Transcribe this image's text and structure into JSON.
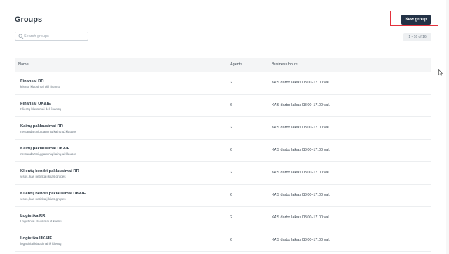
{
  "page": {
    "title": "Groups"
  },
  "toolbar": {
    "new_group_label": "New group"
  },
  "search": {
    "placeholder": "Search groups",
    "value": ""
  },
  "pagination": {
    "label": "1 - 16 of 16"
  },
  "table": {
    "columns": [
      "Name",
      "Agents",
      "Business hours"
    ],
    "rows": [
      {
        "name": "Finansai RR",
        "description": "klientų klausimai dėl finansų",
        "agents": "2",
        "hours": "KAS darbo laikas 08.00-17.00 val."
      },
      {
        "name": "Finansai UK&IE",
        "description": "Klientų klausimai dėl finansų",
        "agents": "6",
        "hours": "KAS darbo laikas 08.00-17.00 val."
      },
      {
        "name": "Kainų paklausimai RR",
        "description": "nestandartinių gaminių kainų užklausos",
        "agents": "2",
        "hours": "KAS darbo laikas 08.00-17.00 val."
      },
      {
        "name": "Kainų paklausimai UK&IE",
        "description": "nestandartinių gaminių kainų užklausos",
        "agents": "6",
        "hours": "KAS darbo laikas 08.00-17.00 val."
      },
      {
        "name": "Klientų bendri paklausimai RR",
        "description": "visos, kas netinka į kitas grupes",
        "agents": "2",
        "hours": "KAS darbo laikas 08.00-17.00 val."
      },
      {
        "name": "Klientų bendri paklausimai UK&IE",
        "description": "visos, kas netinka į kitas grupes",
        "agents": "6",
        "hours": "KAS darbo laikas 08.00-17.00 val."
      },
      {
        "name": "Logistika RR",
        "description": "Logistiniai klausimai iš klientų",
        "agents": "2",
        "hours": "KAS darbo laikas 08.00-17.00 val."
      },
      {
        "name": "Logistika UK&IE",
        "description": "logistiniai klausimai iš klientų",
        "agents": "6",
        "hours": "KAS darbo laikas 08.00-17.00 val."
      }
    ]
  },
  "colors": {
    "primary_button": "#233246",
    "highlight_box": "#e3313c"
  }
}
